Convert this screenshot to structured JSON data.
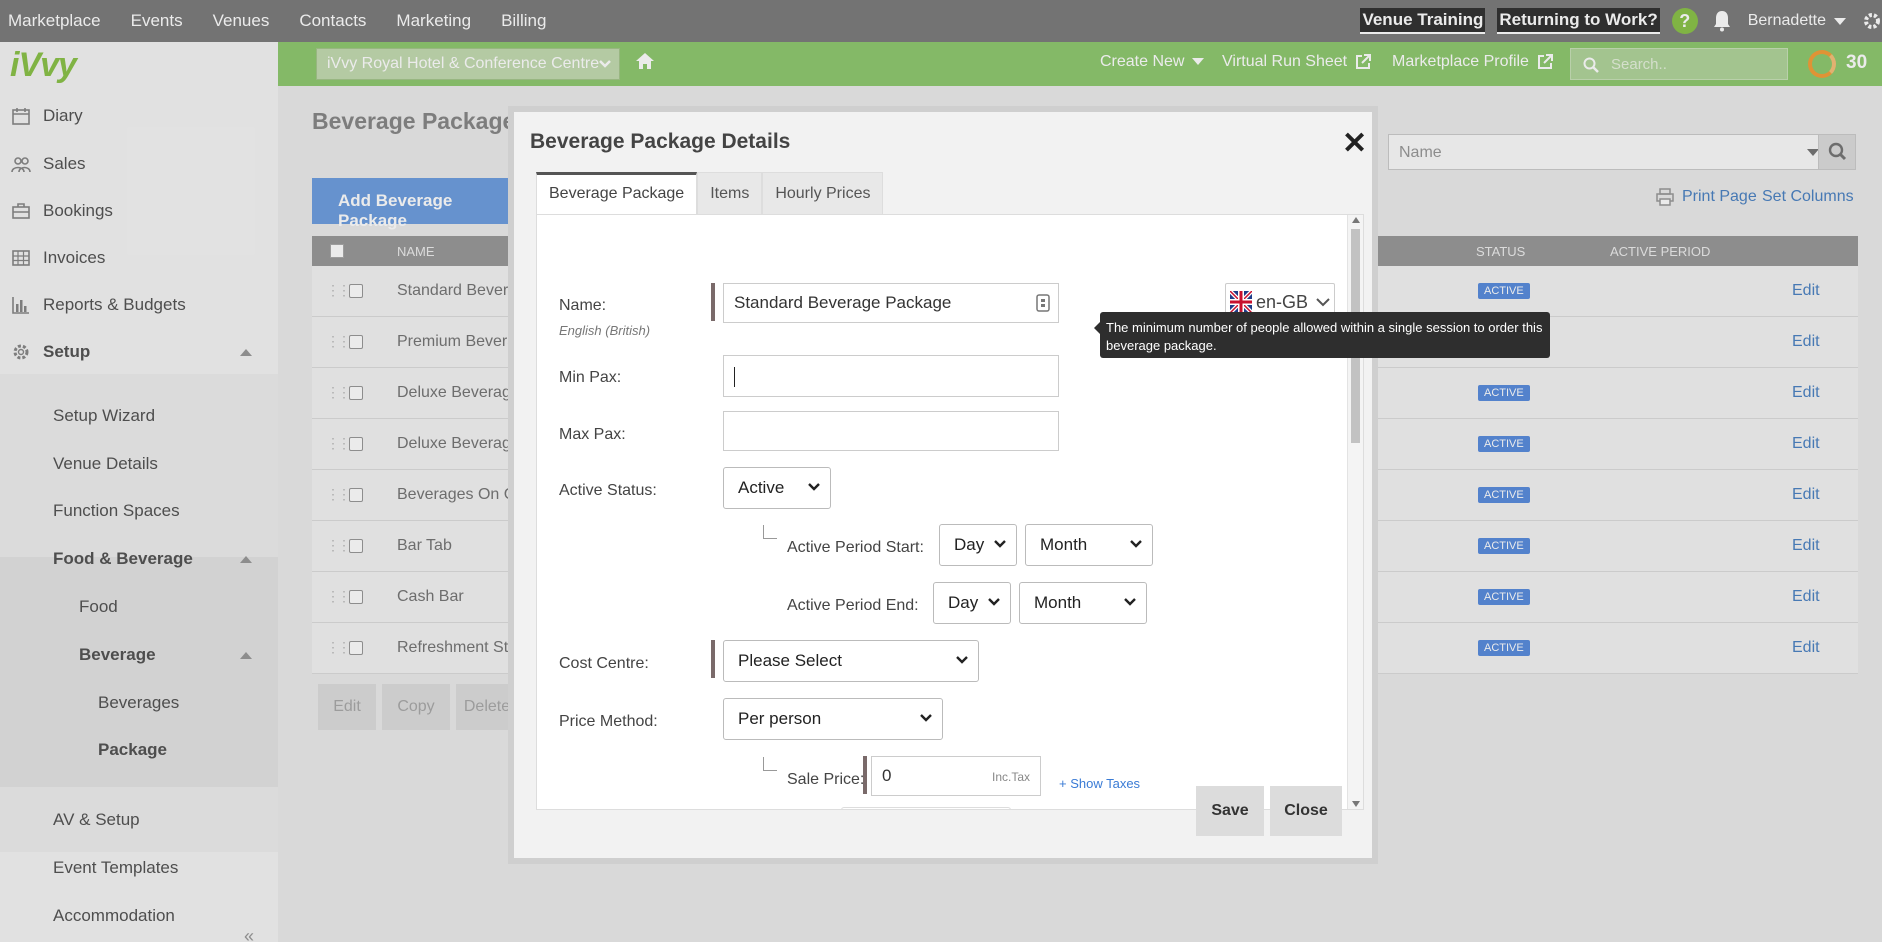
{
  "top_nav": {
    "items": [
      "Marketplace",
      "Events",
      "Venues",
      "Contacts",
      "Marketing",
      "Billing"
    ],
    "venue_training": "Venue Training",
    "returning": "Returning to Work?",
    "help": "?",
    "user": "Bernadette"
  },
  "green_bar": {
    "venue": "iVvy Royal Hotel & Conference Centre",
    "create_new": "Create New",
    "run_sheet": "Virtual Run Sheet",
    "marketplace_profile": "Marketplace Profile",
    "search_placeholder": "Search..",
    "score": "30"
  },
  "sidebar": {
    "logo": "iVvy",
    "items": {
      "diary": "Diary",
      "sales": "Sales",
      "bookings": "Bookings",
      "invoices": "Invoices",
      "reports": "Reports & Budgets",
      "setup": "Setup",
      "setup_wizard": "Setup Wizard",
      "venue_details": "Venue Details",
      "function_spaces": "Function Spaces",
      "food_beverage": "Food & Beverage",
      "food": "Food",
      "beverage": "Beverage",
      "beverages": "Beverages",
      "package": "Package",
      "av_setup": "AV & Setup",
      "event_templates": "Event Templates",
      "accommodation": "Accommodation"
    }
  },
  "page": {
    "title": "Beverage Packages",
    "add_button": "Add Beverage Package",
    "print": "Print Page",
    "set_columns": "Set Columns",
    "filter_placeholder": "Name",
    "columns": {
      "name": "NAME",
      "status": "STATUS",
      "active_period": "ACTIVE PERIOD"
    },
    "rows": [
      {
        "name": "Standard Beverag",
        "status": "ACTIVE",
        "edit": "Edit"
      },
      {
        "name": "Premium Beverag",
        "status": "",
        "edit": "Edit"
      },
      {
        "name": "Deluxe Beverage",
        "status": "ACTIVE",
        "edit": "Edit"
      },
      {
        "name": "Deluxe Beverage",
        "status": "ACTIVE",
        "edit": "Edit"
      },
      {
        "name": "Beverages On Co",
        "status": "ACTIVE",
        "edit": "Edit"
      },
      {
        "name": "Bar Tab",
        "status": "ACTIVE",
        "edit": "Edit"
      },
      {
        "name": "Cash Bar",
        "status": "ACTIVE",
        "edit": "Edit"
      },
      {
        "name": "Refreshment Stat",
        "status": "ACTIVE",
        "edit": "Edit"
      }
    ],
    "bottom_buttons": {
      "edit": "Edit",
      "copy": "Copy",
      "delete": "Delete"
    }
  },
  "modal": {
    "title": "Beverage Package Details",
    "tabs": [
      "Beverage Package",
      "Items",
      "Hourly Prices"
    ],
    "fields": {
      "name_label": "Name:",
      "name_sub": "English (British)",
      "name_value": "Standard Beverage Package",
      "lang": "en-GB",
      "min_pax_label": "Min Pax:",
      "min_pax_value": "",
      "max_pax_label": "Max Pax:",
      "max_pax_value": "",
      "active_status_label": "Active Status:",
      "active_status_value": "Active",
      "period_start_label": "Active Period Start:",
      "period_end_label": "Active Period End:",
      "day": "Day",
      "month": "Month",
      "cost_centre_label": "Cost Centre:",
      "cost_centre_value": "Please Select",
      "price_method_label": "Price Method:",
      "price_method_value": "Per person",
      "sale_price_label": "Sale Price:",
      "sale_price_value": "0",
      "inc_tax": "Inc.Tax",
      "show_taxes": "+ Show Taxes"
    },
    "tooltip": "The minimum number of people allowed within a single session to order this beverage package.",
    "save": "Save",
    "close": "Close"
  },
  "colors": {
    "green_bar": "#90c970",
    "top_nav": "#7d7d7d",
    "accent_blue": "#5b8ede"
  }
}
